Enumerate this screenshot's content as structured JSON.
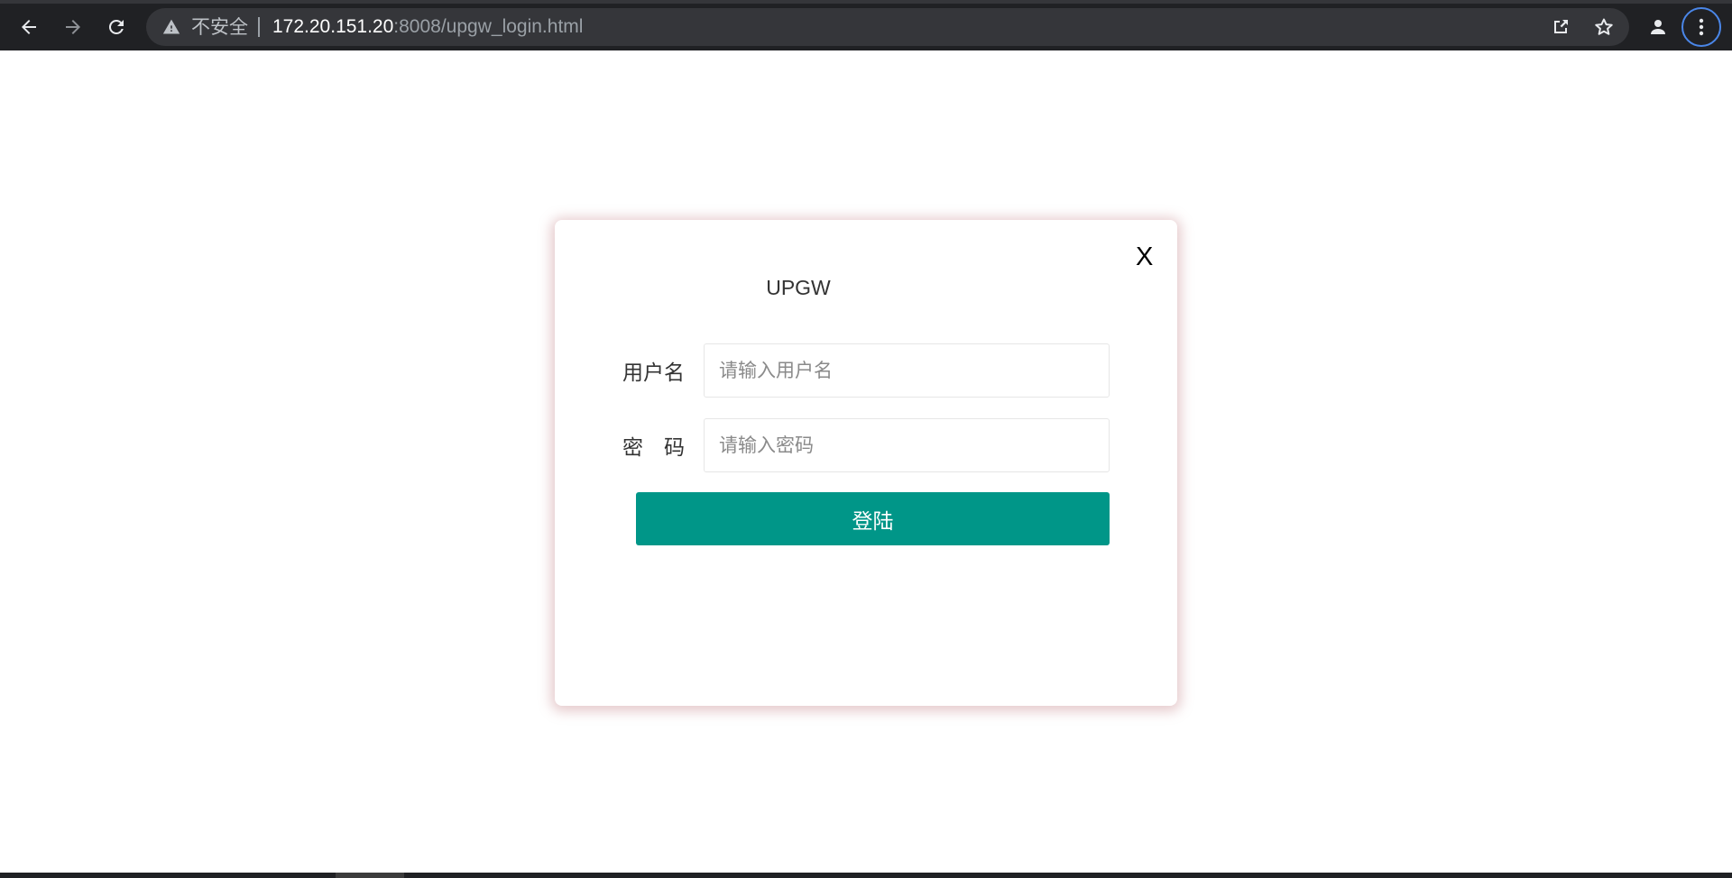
{
  "browser": {
    "security_label": "不安全",
    "url_host": "172.20.151.20",
    "url_rest": ":8008/upgw_login.html",
    "icons": {
      "back": "arrow-left-icon",
      "forward": "arrow-right-icon",
      "reload": "reload-icon",
      "warning": "warning-triangle-icon",
      "share": "share-icon",
      "bookmark": "star-icon",
      "profile": "person-icon",
      "menu": "kebab-menu-icon"
    },
    "colors": {
      "chrome_bg": "#202124",
      "omnibox_bg": "#35363a",
      "focus_ring": "#4a86e8"
    }
  },
  "modal": {
    "close_label": "X",
    "title": "UPGW",
    "username": {
      "label": "用户名",
      "placeholder": "请输入用户名",
      "value": ""
    },
    "password": {
      "label": "密　码",
      "placeholder": "请输入密码",
      "value": ""
    },
    "login_label": "登陆",
    "colors": {
      "primary": "#009688",
      "shadow": "#be787d"
    }
  }
}
